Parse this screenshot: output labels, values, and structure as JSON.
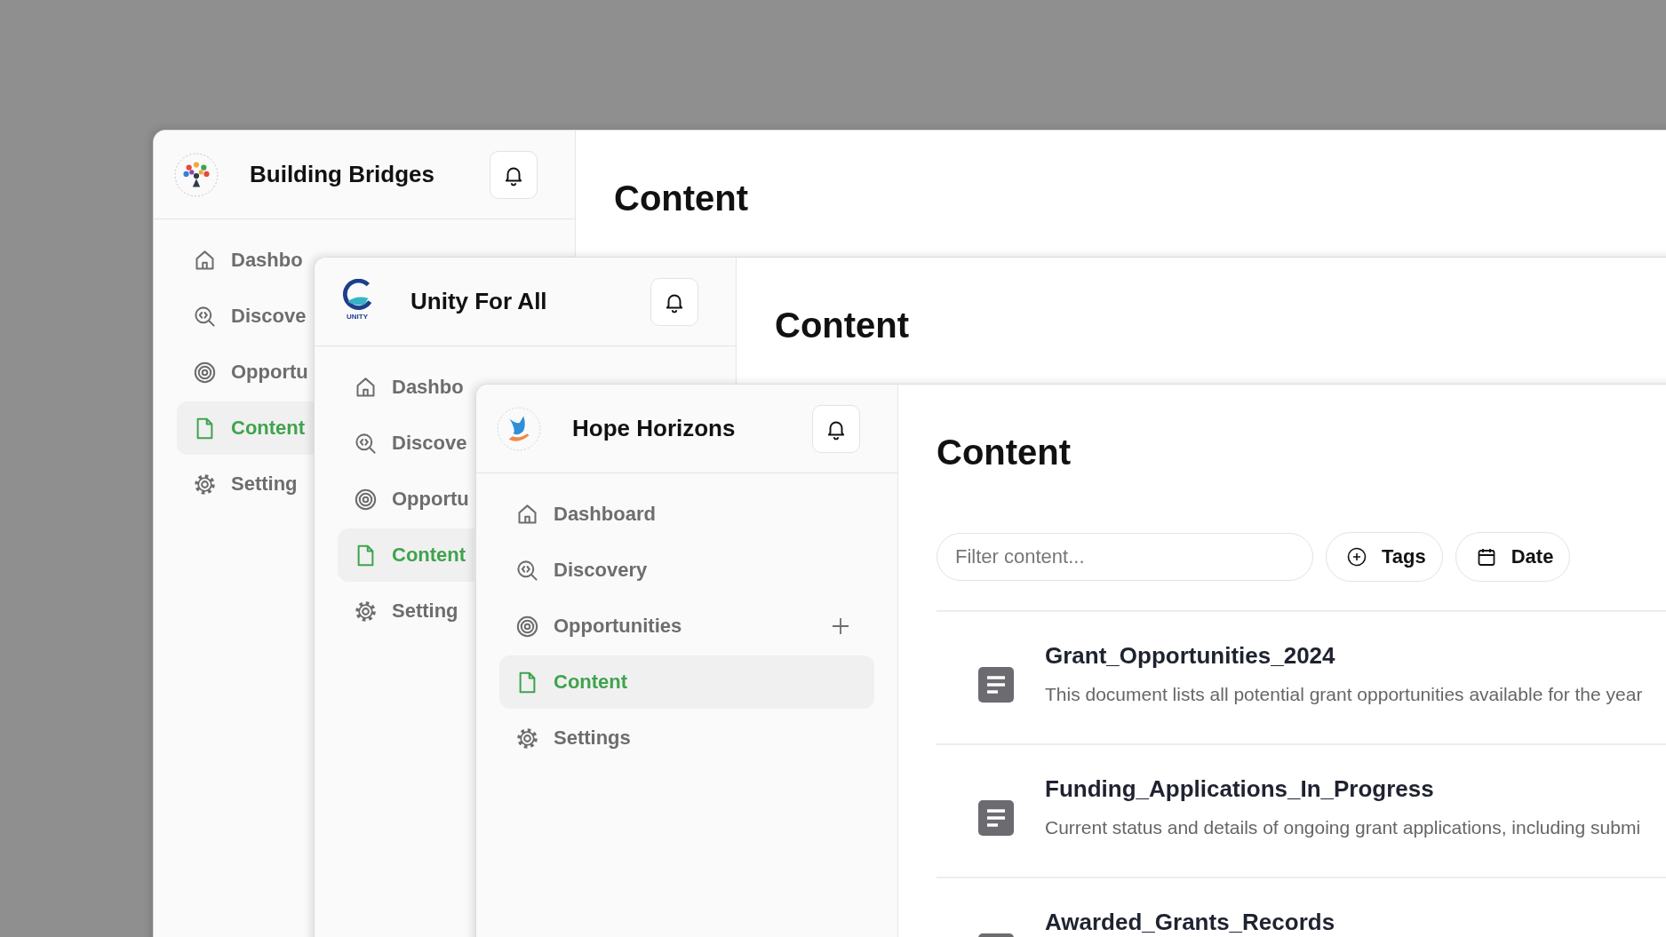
{
  "windows": [
    {
      "org": "Building Bridges",
      "page_title": "Content",
      "nav": [
        {
          "label": "Dashbo",
          "selected": false
        },
        {
          "label": "Discove",
          "selected": false
        },
        {
          "label": "Opportu",
          "selected": false
        },
        {
          "label": "Content",
          "selected": true
        },
        {
          "label": "Setting",
          "selected": false
        }
      ]
    },
    {
      "org": "Unity For All",
      "logo_text": "UNITY",
      "page_title": "Content",
      "nav": [
        {
          "label": "Dashbo",
          "selected": false
        },
        {
          "label": "Discove",
          "selected": false
        },
        {
          "label": "Opportu",
          "selected": false
        },
        {
          "label": "Content",
          "selected": true
        },
        {
          "label": "Setting",
          "selected": false
        }
      ]
    },
    {
      "org": "Hope Horizons",
      "page_title": "Content",
      "nav": [
        {
          "label": "Dashboard",
          "selected": false
        },
        {
          "label": "Discovery",
          "selected": false
        },
        {
          "label": "Opportunities",
          "selected": false,
          "add": true
        },
        {
          "label": "Content",
          "selected": true
        },
        {
          "label": "Settings",
          "selected": false
        }
      ],
      "filter": {
        "placeholder": "Filter content..."
      },
      "filter_buttons": [
        {
          "label": "Tags"
        },
        {
          "label": "Date"
        }
      ],
      "documents": [
        {
          "title": "Grant_Opportunities_2024",
          "description": "This document lists all potential grant opportunities available for the year"
        },
        {
          "title": "Funding_Applications_In_Progress",
          "description": "Current status and details of ongoing grant applications, including submi"
        },
        {
          "title": "Awarded_Grants_Records"
        }
      ]
    }
  ]
}
